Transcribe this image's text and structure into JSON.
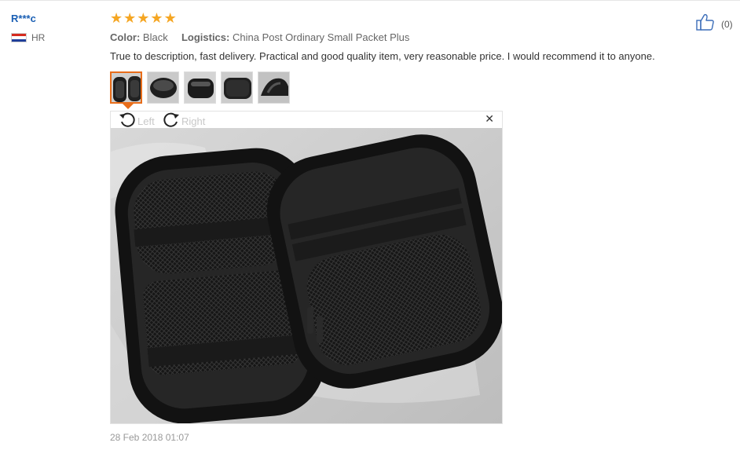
{
  "reviewer": {
    "name": "R***c",
    "country": "HR",
    "flag_colors": [
      "#d52b1e",
      "#ffffff",
      "#1f3f9a"
    ]
  },
  "review": {
    "rating": 5,
    "stars": [
      "★",
      "★",
      "★",
      "★",
      "★"
    ],
    "star_color": "#f5a623",
    "color_label": "Color:",
    "color_value": "Black",
    "logistics_label": "Logistics:",
    "logistics_value": "China Post Ordinary Small Packet Plus",
    "text": "True to description, fast delivery. Practical and good quality item, very reasonable price. I would recommend it to anyone.",
    "date": "28 Feb 2018 01:07"
  },
  "helpful": {
    "icon": "thumbs-up-icon",
    "count": "(0)"
  },
  "thumbnails": [
    {
      "name": "thumbnail-1",
      "active": true
    },
    {
      "name": "thumbnail-2",
      "active": false
    },
    {
      "name": "thumbnail-3",
      "active": false
    },
    {
      "name": "thumbnail-4",
      "active": false
    },
    {
      "name": "thumbnail-5",
      "active": false
    }
  ],
  "viewer": {
    "rotate_left_label": "Left",
    "rotate_right_label": "Right",
    "close_glyph": "✕",
    "rotate_left_icon": "rotate-left-icon",
    "rotate_right_icon": "rotate-right-icon",
    "close_icon": "close-icon"
  },
  "accent_color": "#e86d1a",
  "link_color": "#1a5fb4"
}
